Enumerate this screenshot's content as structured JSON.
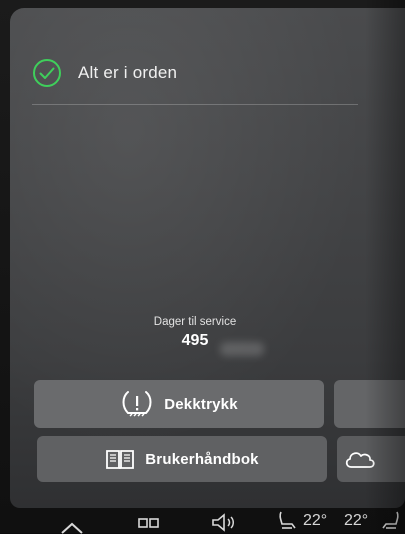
{
  "status": {
    "message": "Alt er i orden",
    "icon": "check-circle-icon",
    "icon_color": "#3fcf5b"
  },
  "service": {
    "label": "Dager til service",
    "value": "495"
  },
  "tiles": [
    {
      "label": "Dekktrykk",
      "icon": "tire-pressure-warning-icon"
    },
    {
      "label": "Brukerhåndbok",
      "icon": "manual-book-icon"
    }
  ],
  "side_tiles": [
    {
      "icon": "cloud-icon"
    }
  ],
  "bottom_bar": {
    "temp_left": "22°",
    "temp_right": "22°",
    "icons": [
      "home-icon",
      "apps-grid-icon",
      "volume-icon",
      "seat-heat-left-icon",
      "seat-heat-right-icon"
    ]
  }
}
